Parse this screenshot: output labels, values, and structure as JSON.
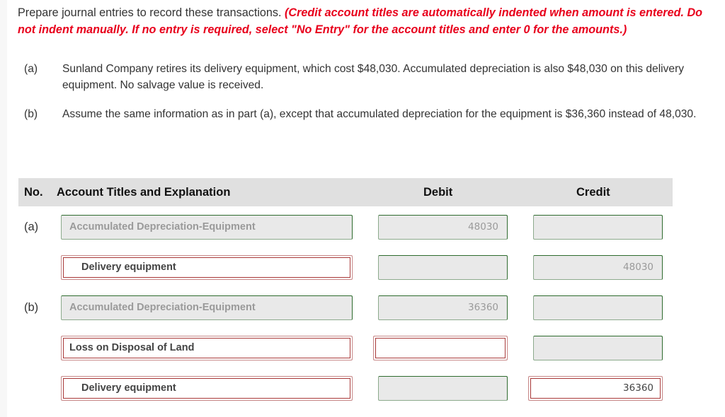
{
  "instructions": {
    "text": "Prepare journal entries to record these transactions. ",
    "note": "(Credit account titles are automatically indented when amount is entered. Do not indent manually. If no entry is required, select \"No Entry\" for the account titles and enter 0 for the amounts.)"
  },
  "questions": [
    {
      "label": "(a)",
      "text": "Sunland Company retires its delivery equipment, which cost $48,030. Accumulated depreciation is also $48,030 on this delivery equipment. No salvage value is received."
    },
    {
      "label": "(b)",
      "text": "Assume the same information as in part (a), except that accumulated depreciation for the equipment is $36,360 instead of 48,030."
    }
  ],
  "table": {
    "headers": {
      "no": "No.",
      "account": "Account Titles and Explanation",
      "debit": "Debit",
      "credit": "Credit"
    },
    "rows": [
      {
        "no": "(a)",
        "account": "Accumulated Depreciation-Equipment",
        "debit": "48030",
        "credit": "",
        "account_state": "correct",
        "debit_state": "correct",
        "credit_state": "correct"
      },
      {
        "no": "",
        "account": "Delivery equipment",
        "debit": "",
        "credit": "48030",
        "account_state": "incorrect",
        "debit_state": "correct",
        "credit_state": "correct"
      },
      {
        "no": "(b)",
        "account": "Accumulated Depreciation-Equipment",
        "debit": "36360",
        "credit": "",
        "account_state": "correct",
        "debit_state": "correct",
        "credit_state": "correct"
      },
      {
        "no": "",
        "account": "Loss on Disposal of Land",
        "debit": "",
        "credit": "",
        "account_state": "incorrect",
        "debit_state": "incorrect",
        "credit_state": "correct"
      },
      {
        "no": "",
        "account": "Delivery equipment",
        "debit": "",
        "credit": "36360",
        "account_state": "incorrect",
        "debit_state": "correct",
        "credit_state": "incorrect"
      }
    ]
  },
  "colors": {
    "instruction_red": "#e8001c",
    "correct_border": "#2e6b2e",
    "incorrect_border": "#a83838",
    "header_bg": "#e0e0e0"
  }
}
